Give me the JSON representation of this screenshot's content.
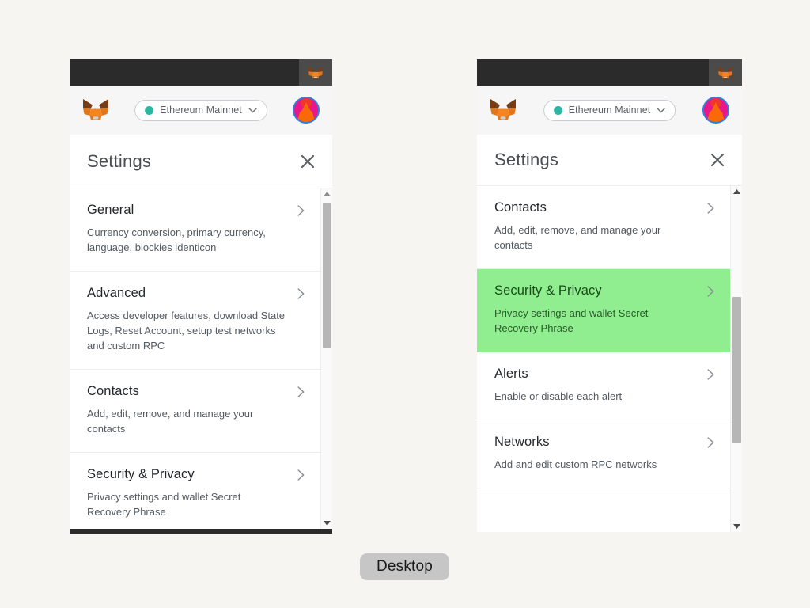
{
  "page": {
    "background_color": "#f7f5f2",
    "footer_chip_label": "Desktop",
    "highlight_color": "#90ee90"
  },
  "panels": [
    {
      "id": "left",
      "browser": {
        "extension_icon": "metamask-fox-icon"
      },
      "app_header": {
        "brand_icon": "metamask-fox-logo",
        "network_label": "Ethereum Mainnet",
        "network_status_color": "#29b6a3",
        "network_chevron_icon": "chevron-down-icon",
        "avatar_icon": "account-blockie-avatar"
      },
      "settings": {
        "title": "Settings",
        "close_icon": "close-icon"
      },
      "scrollbar": {
        "up_icon": "scroll-up-arrow-icon",
        "down_icon": "scroll-down-arrow-icon",
        "thumb_top_pct": 4,
        "thumb_height_pct": 44
      },
      "rows": [
        {
          "title": "General",
          "description": "Currency conversion, primary currency, language, blockies identicon",
          "chevron_icon": "chevron-right-icon",
          "highlighted": false
        },
        {
          "title": "Advanced",
          "description": "Access developer features, download State Logs, Reset Account, setup test networks and custom RPC",
          "chevron_icon": "chevron-right-icon",
          "highlighted": false
        },
        {
          "title": "Contacts",
          "description": "Add, edit, remove, and manage your contacts",
          "chevron_icon": "chevron-right-icon",
          "highlighted": false
        },
        {
          "title": "Security & Privacy",
          "description": "Privacy settings and wallet Secret Recovery Phrase",
          "chevron_icon": "chevron-right-icon",
          "highlighted": false
        }
      ]
    },
    {
      "id": "right",
      "browser": {
        "extension_icon": "metamask-fox-icon"
      },
      "app_header": {
        "brand_icon": "metamask-fox-logo",
        "network_label": "Ethereum Mainnet",
        "network_status_color": "#29b6a3",
        "network_chevron_icon": "chevron-down-icon",
        "avatar_icon": "account-blockie-avatar"
      },
      "settings": {
        "title": "Settings",
        "close_icon": "close-icon"
      },
      "scrollbar": {
        "up_icon": "scroll-up-arrow-icon",
        "down_icon": "scroll-down-arrow-icon",
        "thumb_top_pct": 34,
        "thumb_height_pct": 44
      },
      "rows": [
        {
          "title": "Contacts",
          "description": "Add, edit, remove, and manage your contacts",
          "chevron_icon": "chevron-right-icon",
          "highlighted": false
        },
        {
          "title": "Security & Privacy",
          "description": "Privacy settings and wallet Secret Recovery Phrase",
          "chevron_icon": "chevron-right-icon",
          "highlighted": true
        },
        {
          "title": "Alerts",
          "description": "Enable or disable each alert",
          "chevron_icon": "chevron-right-icon",
          "highlighted": false
        },
        {
          "title": "Networks",
          "description": "Add and edit custom RPC networks",
          "chevron_icon": "chevron-right-icon",
          "highlighted": false
        }
      ]
    }
  ]
}
